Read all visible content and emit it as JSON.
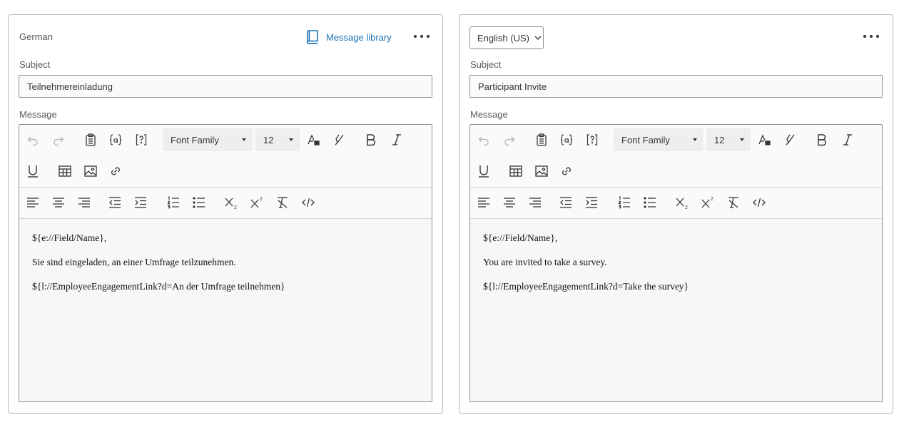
{
  "left_panel": {
    "language_label": "German",
    "message_library_label": "Message library",
    "subject_label": "Subject",
    "subject_value": "Teilnehmereinladung",
    "message_label": "Message",
    "toolbar": {
      "font_family": "Font Family",
      "font_size": "12"
    },
    "body_lines": [
      "${e://Field/Name},",
      "Sie sind eingeladen, an einer Umfrage teilzunehmen.",
      "${l://EmployeeEngagementLink?d=An der Umfrage teilnehmen}"
    ]
  },
  "right_panel": {
    "language_select": "English (US)",
    "subject_label": "Subject",
    "subject_value": "Participant Invite",
    "message_label": "Message",
    "toolbar": {
      "font_family": "Font Family",
      "font_size": "12"
    },
    "body_lines": [
      "${e://Field/Name},",
      "You are invited to take a survey.",
      "${l://EmployeeEngagementLink?d=Take the survey}"
    ]
  },
  "icons": {
    "toolbar_row1": [
      "undo-icon",
      "redo-icon",
      "paste-icon",
      "piped-text-icon",
      "help-icon",
      "font-color-icon",
      "highlight-icon",
      "bold-icon",
      "italic-icon"
    ],
    "toolbar_row1b": [
      "underline-icon",
      "table-icon",
      "image-icon",
      "link-icon"
    ],
    "toolbar_row2": [
      "align-left-icon",
      "align-center-icon",
      "align-right-icon",
      "outdent-icon",
      "indent-icon",
      "ordered-list-icon",
      "bullet-list-icon",
      "subscript-icon",
      "superscript-icon",
      "clear-format-icon",
      "source-code-icon"
    ],
    "header": [
      "book-icon",
      "more-options-icon",
      "chevron-down-icon"
    ]
  },
  "colors": {
    "link_blue": "#1a73b8",
    "border": "#8a8d91",
    "editor_bg": "#f7f7f7"
  }
}
